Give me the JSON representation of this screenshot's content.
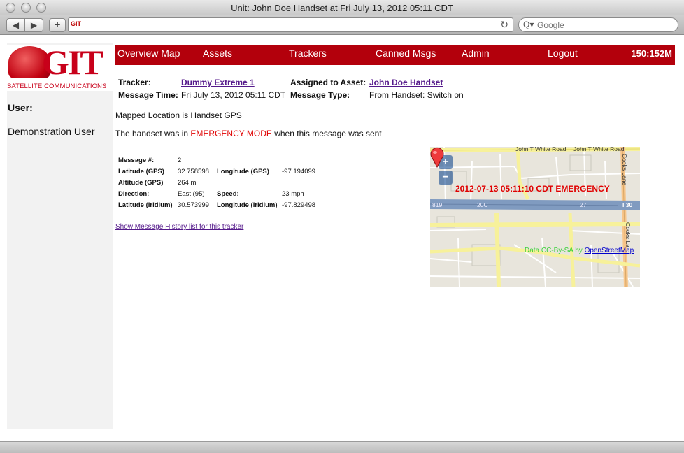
{
  "window": {
    "title": "Unit: John Doe Handset at Fri July 13, 2012 05:11 CDT"
  },
  "toolbar": {
    "back_glyph": "◀",
    "forward_glyph": "▶",
    "add_glyph": "+",
    "favicon_text": "GIT",
    "reload_glyph": "↻",
    "search_placeholder": "Google",
    "search_glyph": "Q▾"
  },
  "sidebar": {
    "logo_text": "GIT",
    "logo_sub": "SATELLITE COMMUNICATIONS",
    "user_label": "User:",
    "user_name": "Demonstration User"
  },
  "nav": {
    "items": [
      "Overview Map",
      "Assets",
      "Trackers",
      "Canned Msgs",
      "Admin",
      "Logout"
    ],
    "status": "150:152M"
  },
  "header": {
    "tracker_label": "Tracker:",
    "tracker_value": "Dummy Extreme 1",
    "asset_label": "Assigned to Asset:",
    "asset_value": "John Doe Handset",
    "time_label": "Message Time:",
    "time_value": "Fri July 13, 2012 05:11 CDT",
    "type_label": "Message Type:",
    "type_value": "From Handset: Switch on"
  },
  "notes": {
    "mapped": "Mapped Location is Handset GPS",
    "emerg_prefix": "The handset was in ",
    "emerg_mode": "EMERGENCY MODE",
    "emerg_suffix": " when this message was sent"
  },
  "details": {
    "message_num_label": "Message #:",
    "message_num": "2",
    "lat_gps_label": "Latitude (GPS)",
    "lat_gps": "32.758598",
    "lon_gps_label": "Longitude (GPS)",
    "lon_gps": "-97.194099",
    "alt_gps_label": "Altitude (GPS)",
    "alt_gps": "264 m",
    "direction_label": "Direction:",
    "direction": "East (95)",
    "speed_label": "Speed:",
    "speed": "23 mph",
    "lat_iri_label": "Latitude (Iridium)",
    "lat_iri": "30.573999",
    "lon_iri_label": "Longitude (Iridium)",
    "lon_iri": "-97.829498"
  },
  "history_link": "Show Message History list for this tracker",
  "map": {
    "zoom_in": "+",
    "zoom_out": "−",
    "label": "2012-07-13 05:11:10 CDT EMERGENCY",
    "attribution": "Data CC-By-SA by ",
    "attribution_link": "OpenStreetMap",
    "roads": {
      "north_road_1": "John T White Road",
      "north_road_2": "John T White Road",
      "east_road": "Cooks Lane",
      "east_road_2": "Cooks La",
      "highway": "I 30",
      "hwy_label_1": "819",
      "hwy_label_2": "20C",
      "hwy_label_3": "27"
    }
  },
  "colors": {
    "nav_bg": "#b3000c",
    "emergency": "#e00000",
    "link_visited": "#551a8b"
  }
}
